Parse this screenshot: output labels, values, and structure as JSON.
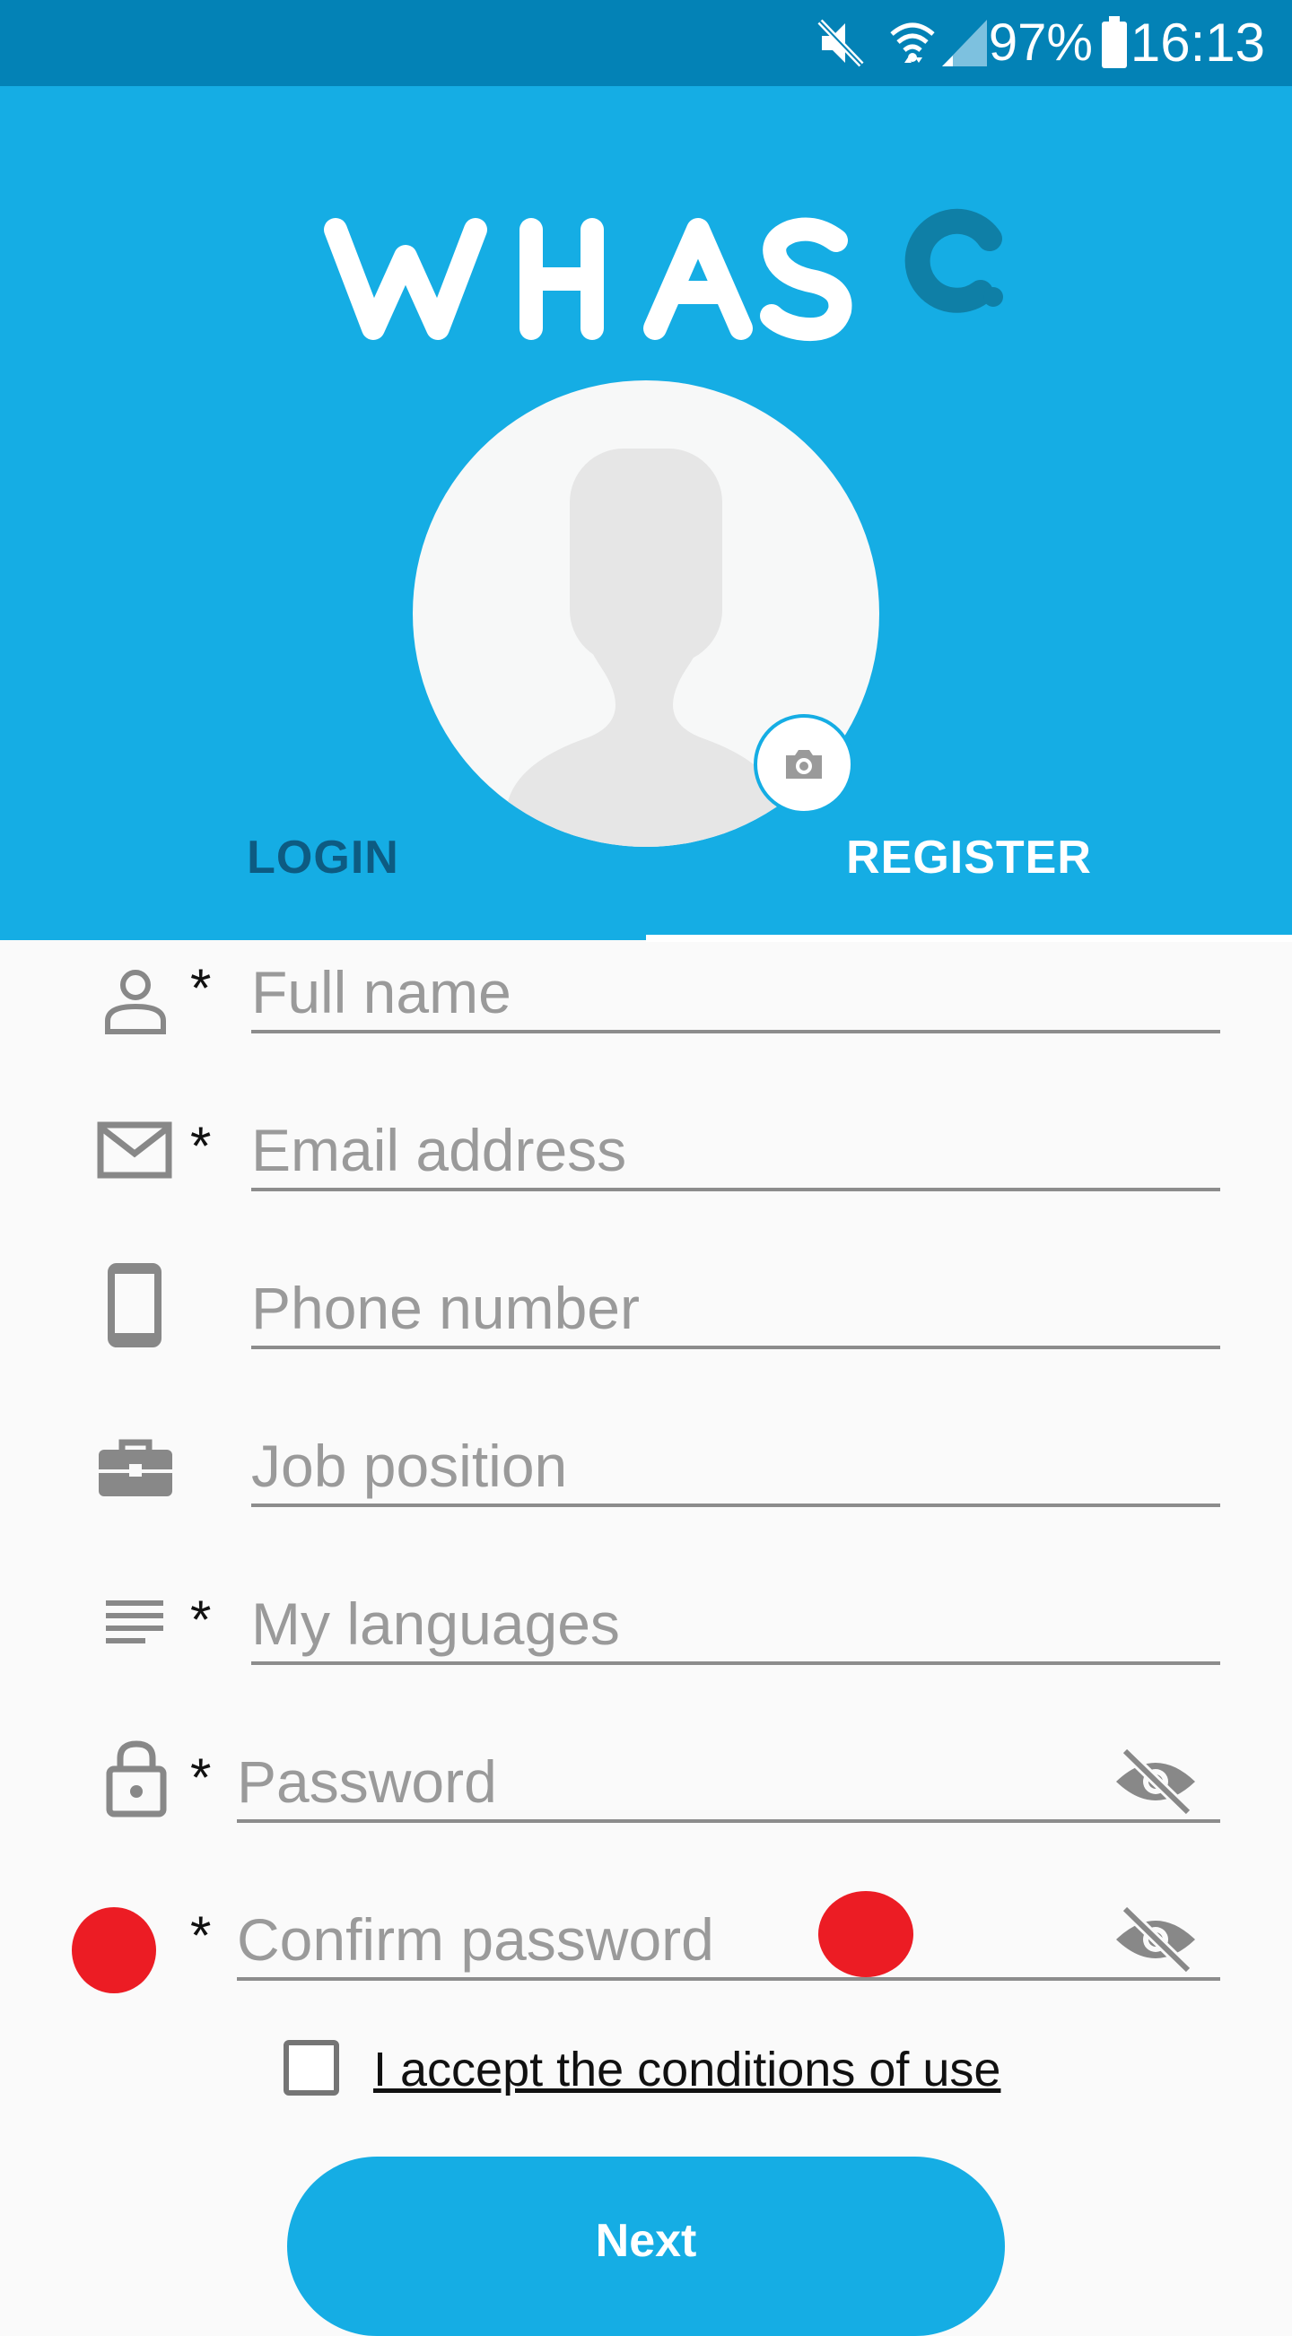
{
  "status_bar": {
    "battery": "97%",
    "time": "16:13",
    "icons": [
      "mute-icon",
      "wifi-icon",
      "signal-icon",
      "battery-icon"
    ]
  },
  "header": {
    "logo_text": "WHASQ",
    "tabs": [
      {
        "label": "LOGIN",
        "active": false
      },
      {
        "label": "REGISTER",
        "active": true
      }
    ]
  },
  "form": {
    "fields": [
      {
        "placeholder": "Full name",
        "required": true,
        "icon": "person-icon"
      },
      {
        "placeholder": "Email address",
        "required": true,
        "icon": "email-icon"
      },
      {
        "placeholder": "Phone number",
        "required": false,
        "icon": "phone-icon"
      },
      {
        "placeholder": "Job position",
        "required": false,
        "icon": "briefcase-icon"
      },
      {
        "placeholder": "My languages",
        "required": true,
        "icon": "list-icon"
      },
      {
        "placeholder": "Password",
        "required": true,
        "icon": "lock-icon"
      },
      {
        "placeholder": "Confirm password",
        "required": true,
        "icon": ""
      }
    ],
    "required_mark": "*",
    "terms_label": "I accept the conditions of use",
    "terms_checked": false,
    "next_label": "Next"
  },
  "colors": {
    "primary": "#15ade4",
    "status_bar": "#0382b6",
    "login_tab": "#0d5b82",
    "logo_accent": "#0f7fa6",
    "annotation": "#ec1c24"
  }
}
